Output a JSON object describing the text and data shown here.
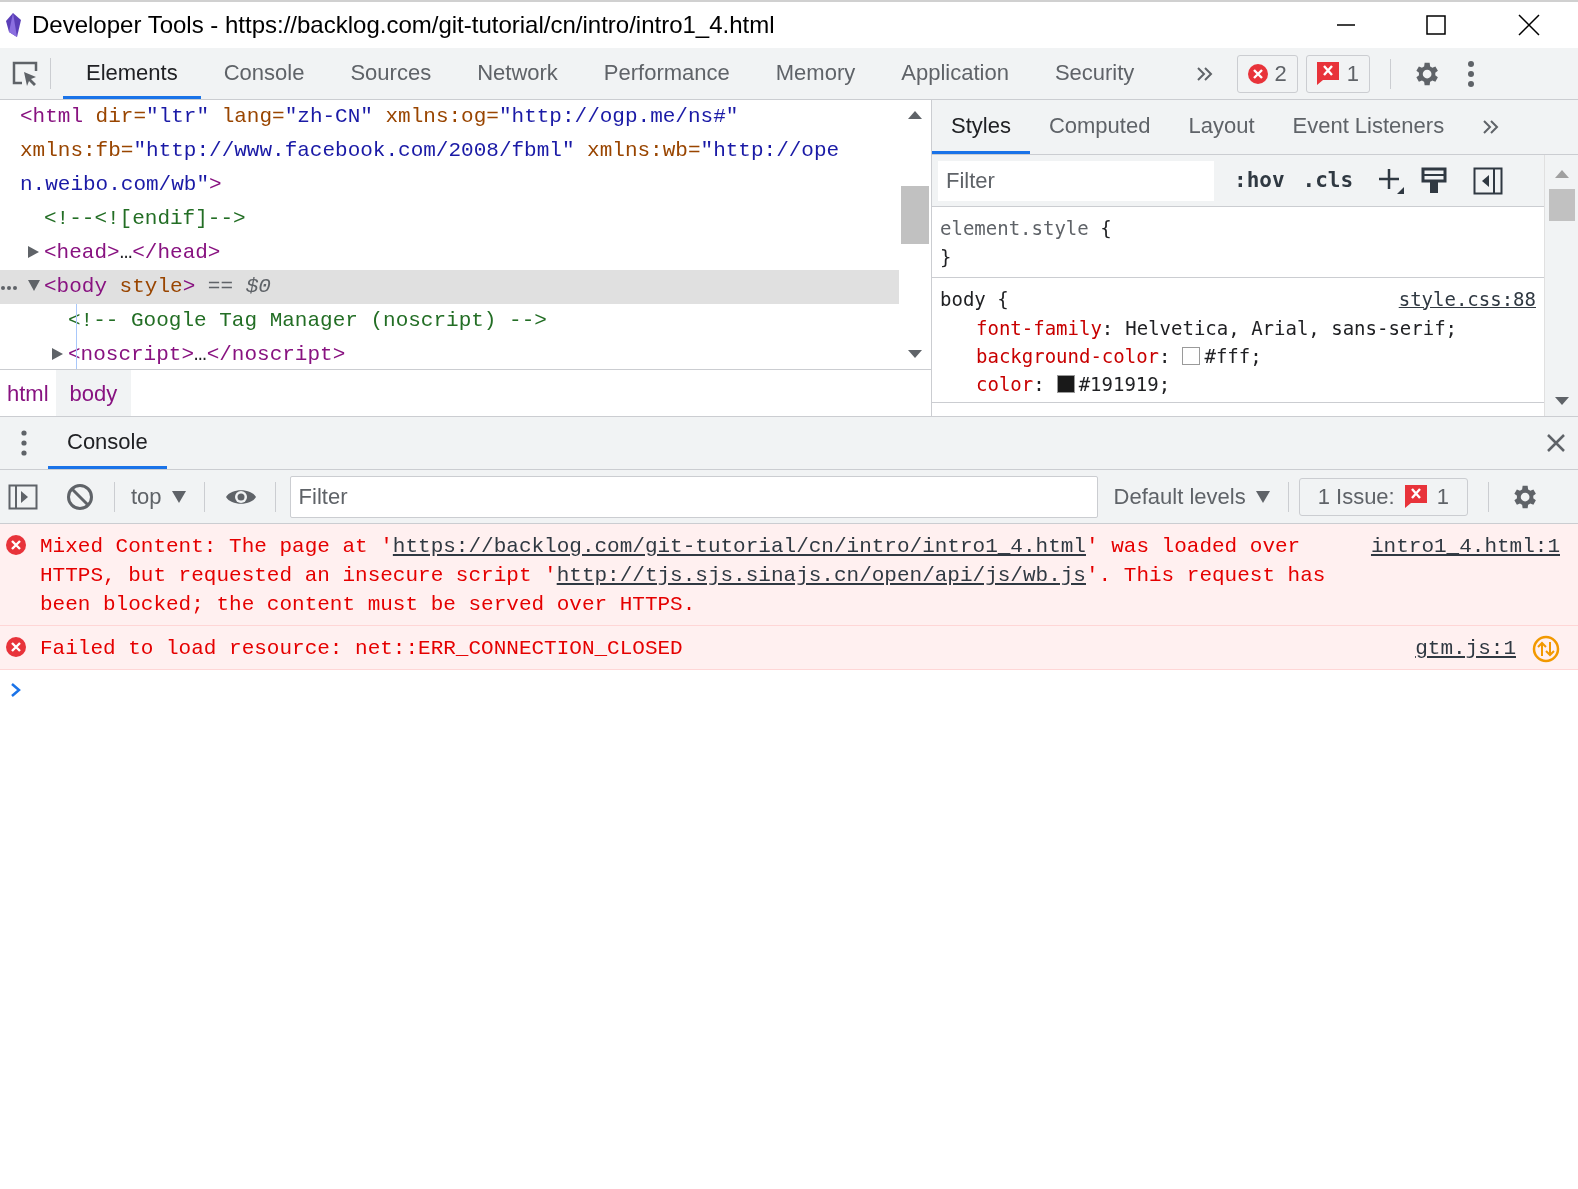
{
  "window": {
    "title": "Developer Tools - https://backlog.com/git-tutorial/cn/intro/intro1_4.html"
  },
  "main_tabs": [
    {
      "label": "Elements",
      "selected": true
    },
    {
      "label": "Console",
      "selected": false
    },
    {
      "label": "Sources",
      "selected": false
    },
    {
      "label": "Network",
      "selected": false
    },
    {
      "label": "Performance",
      "selected": false
    },
    {
      "label": "Memory",
      "selected": false
    },
    {
      "label": "Application",
      "selected": false
    },
    {
      "label": "Security",
      "selected": false
    }
  ],
  "error_badge": {
    "count": "2"
  },
  "issue_badge": {
    "count": "1"
  },
  "dom_tree": [
    {
      "selected": false,
      "lines": [
        [
          {
            "kind": "tag",
            "text": "<html"
          },
          {
            "kind": "attr",
            "text": " dir="
          },
          {
            "kind": "value",
            "text": "\"ltr\""
          },
          {
            "kind": "attr",
            "text": " lang="
          },
          {
            "kind": "value",
            "text": "\"zh-CN\""
          },
          {
            "kind": "attr",
            "text": " xmlns:og="
          },
          {
            "kind": "value",
            "text": "\"http://ogp.me/ns#\""
          }
        ],
        [
          {
            "kind": "attr",
            "text": "xmlns:fb="
          },
          {
            "kind": "value",
            "text": "\"http://www.facebook.com/2008/fbml\""
          },
          {
            "kind": "attr",
            "text": " xmlns:wb="
          },
          {
            "kind": "value",
            "text": "\"http://ope"
          }
        ],
        [
          {
            "kind": "value",
            "text": "n.weibo.com/wb\""
          },
          {
            "kind": "tag",
            "text": ">"
          }
        ]
      ],
      "children": [
        {
          "selected": false,
          "lines": [
            [
              {
                "kind": "comment",
                "text": "<!--<![endif]-->"
              }
            ]
          ]
        },
        {
          "selected": false,
          "expanded": false,
          "lines": [
            [
              {
                "kind": "tag",
                "text": "<head>"
              },
              {
                "kind": "plain",
                "text": "…"
              },
              {
                "kind": "tag",
                "text": "</head>"
              }
            ]
          ]
        },
        {
          "selected": true,
          "expanded": true,
          "lines": [
            [
              {
                "kind": "tag",
                "text": "<body"
              },
              {
                "kind": "attr",
                "text": " style"
              },
              {
                "kind": "tag",
                "text": ">"
              },
              {
                "kind": "marker",
                "text": " == $0"
              }
            ]
          ],
          "children": [
            {
              "selected": false,
              "lines": [
                [
                  {
                    "kind": "comment",
                    "text": "<!-- Google Tag Manager (noscript) -->"
                  }
                ]
              ]
            },
            {
              "selected": false,
              "expanded": false,
              "lines": [
                [
                  {
                    "kind": "tag",
                    "text": "<noscript>"
                  },
                  {
                    "kind": "plain",
                    "text": "…"
                  },
                  {
                    "kind": "tag",
                    "text": "</noscript>"
                  }
                ]
              ]
            }
          ]
        }
      ]
    }
  ],
  "breadcrumbs": [
    {
      "label": "html",
      "selected": false
    },
    {
      "label": "body",
      "selected": true
    }
  ],
  "styles_tabs": [
    {
      "label": "Styles",
      "selected": true
    },
    {
      "label": "Computed",
      "selected": false
    },
    {
      "label": "Layout",
      "selected": false
    },
    {
      "label": "Event Listeners",
      "selected": false
    }
  ],
  "styles_toolbar": {
    "placeholder": "Filter",
    "hov": ":hov",
    "cls": ".cls"
  },
  "rules": [
    {
      "kind": "inline",
      "selector": "element.style",
      "open": "{",
      "close": "}"
    },
    {
      "kind": "stylesheet",
      "selector": "body",
      "open": "{",
      "source": "style.css:88",
      "declarations": [
        {
          "kind": "plain",
          "property": "font-family",
          "colon": ":",
          "value": "Helvetica, Arial, sans-serif;"
        },
        {
          "kind": "color",
          "property": "background-color",
          "colon": ":",
          "value": "#fff;"
        },
        {
          "kind": "color",
          "property": "color",
          "colon": ":",
          "value": "#191919;"
        }
      ]
    }
  ],
  "drawer": {
    "tabs": [
      {
        "label": "Console",
        "selected": true
      }
    ],
    "context": "top",
    "placeholder": "Filter",
    "levels": "Default levels",
    "issues": {
      "label": "1 Issue:",
      "count": "1"
    }
  },
  "messages": [
    {
      "kind": "error",
      "source": "intro1_4.html:1",
      "parts": [
        {
          "kind": "text",
          "text": "Mixed Content: The page at '"
        },
        {
          "kind": "link",
          "text": "https://backlog.com/git-tutorial/cn/intro/intro1_4.html"
        },
        {
          "kind": "text",
          "text": "' was loaded over HTTPS, but requested an insecure script '"
        },
        {
          "kind": "link",
          "text": "http://tjs.sjs.sinajs.cn/open/api/js/wb.js"
        },
        {
          "kind": "text",
          "text": "'. This request has been blocked; the content must be served over HTTPS."
        }
      ]
    },
    {
      "kind": "error",
      "source": "gtm.js:1",
      "network_icon": true,
      "parts": [
        {
          "kind": "text",
          "text": "Failed to load resource: net::ERR_CONNECTION_CLOSED"
        }
      ]
    }
  ]
}
